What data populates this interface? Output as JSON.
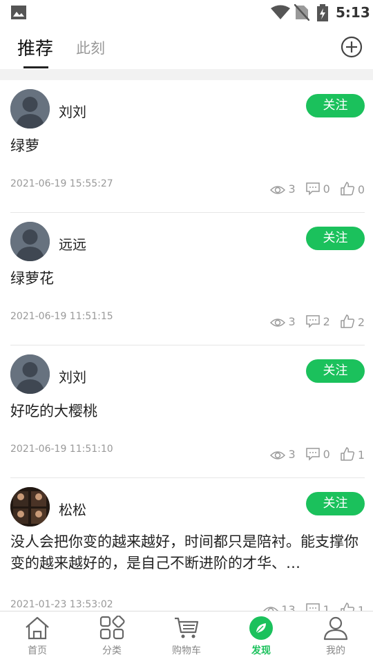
{
  "status_bar": {
    "time": "5:13"
  },
  "header": {
    "tabs": [
      {
        "label": "推荐",
        "active": true
      },
      {
        "label": "此刻",
        "active": false
      }
    ]
  },
  "posts": [
    {
      "username": "刘刘",
      "follow_label": "关注",
      "content": "绿萝",
      "time": "2021-06-19 15:55:27",
      "views": "3",
      "comments": "0",
      "likes": "0",
      "avatar": "default"
    },
    {
      "username": "远远",
      "follow_label": "关注",
      "content": "绿萝花",
      "time": "2021-06-19 11:51:15",
      "views": "3",
      "comments": "2",
      "likes": "2",
      "avatar": "default"
    },
    {
      "username": "刘刘",
      "follow_label": "关注",
      "content": "好吃的大樱桃",
      "time": "2021-06-19 11:51:10",
      "views": "3",
      "comments": "0",
      "likes": "1",
      "avatar": "default"
    },
    {
      "username": "松松",
      "follow_label": "关注",
      "content": "没人会把你变的越来越好，时间都只是陪衬。能支撑你变的越来越好的，是自己不断进阶的才华、…",
      "time": "2021-01-23 13:53:02",
      "views": "13",
      "comments": "1",
      "likes": "1",
      "avatar": "photo"
    }
  ],
  "bottom_nav": [
    {
      "label": "首页",
      "icon": "home-icon",
      "active": false
    },
    {
      "label": "分类",
      "icon": "category-icon",
      "active": false
    },
    {
      "label": "购物车",
      "icon": "cart-icon",
      "active": false
    },
    {
      "label": "发现",
      "icon": "discover-icon",
      "active": true
    },
    {
      "label": "我的",
      "icon": "profile-icon",
      "active": false
    }
  ],
  "colors": {
    "accent": "#1bc15c",
    "muted": "#999999"
  }
}
